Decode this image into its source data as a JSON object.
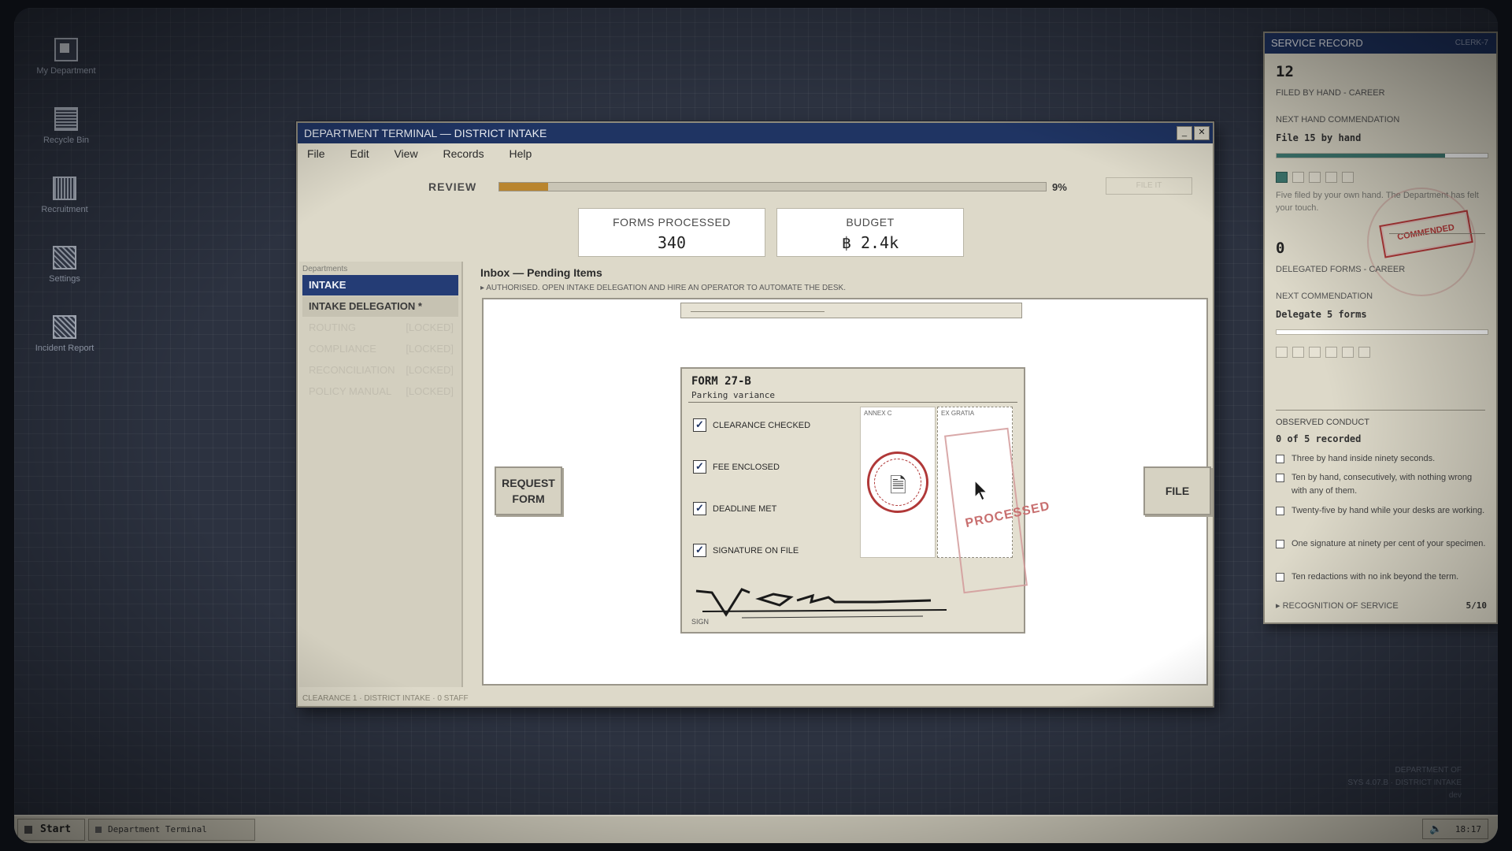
{
  "desktop": {
    "icons": [
      {
        "label": "My Department",
        "icon": "folder-icon"
      },
      {
        "label": "Recycle Bin",
        "icon": "recycle-bin-icon"
      },
      {
        "label": "Recruitment",
        "icon": "recruitment-icon"
      },
      {
        "label": "Settings",
        "icon": "settings-icon"
      },
      {
        "label": "Incident Report",
        "icon": "report-icon"
      }
    ],
    "system_info": [
      "DEPARTMENT OF",
      "SYS 4.07.B · DISTRICT INTAKE",
      "dev"
    ]
  },
  "window": {
    "title": "DEPARTMENT TERMINAL — DISTRICT INTAKE",
    "minimize": "_",
    "close": "✕",
    "menu": [
      "File",
      "Edit",
      "View",
      "Records",
      "Help"
    ],
    "review": {
      "label": "REVIEW",
      "progress_percent": 9,
      "percent_label": "9%",
      "file_it": "FILE IT"
    },
    "stats": {
      "forms_processed_label": "FORMS PROCESSED",
      "forms_processed_value": "340",
      "budget_label": "BUDGET",
      "budget_value": "฿ 2.4k"
    },
    "sidebar": {
      "heading": "Departments",
      "items": [
        {
          "label": "INTAKE",
          "state": "active"
        },
        {
          "label": "INTAKE DELEGATION *",
          "state": "available"
        },
        {
          "label": "ROUTING",
          "state": "locked",
          "lock": "[LOCKED]"
        },
        {
          "label": "COMPLIANCE",
          "state": "locked",
          "lock": "[LOCKED]"
        },
        {
          "label": "RECONCILIATION",
          "state": "locked",
          "lock": "[LOCKED]"
        },
        {
          "label": "POLICY MANUAL",
          "state": "locked",
          "lock": "[LOCKED]"
        }
      ]
    },
    "inbox": {
      "title": "Inbox — Pending Items",
      "notice": "▸ AUTHORISED. OPEN INTAKE DELEGATION AND HIRE AN OPERATOR TO AUTOMATE THE DESK."
    },
    "request_button": "REQUEST FORM",
    "file_button": "FILE",
    "form": {
      "title": "FORM 27-B",
      "subtitle": "Parking variance",
      "checks": [
        "CLEARANCE CHECKED",
        "FEE ENCLOSED",
        "DEADLINE MET",
        "SIGNATURE ON FILE"
      ],
      "check_mark": "✓",
      "annex_left": "ANNEX C",
      "annex_right": "EX GRATIA",
      "stamp_text": "PROCESSED",
      "signature_label": "SIGN"
    },
    "status": "CLEARANCE 1 · DISTRICT INTAKE · 0 STAFF"
  },
  "service_record": {
    "title": "SERVICE RECORD",
    "clerk": "CLERK-7",
    "filed_value": "12",
    "filed_label": "FILED BY HAND - CAREER",
    "next_hand_label": "NEXT HAND COMMENDATION",
    "next_hand_value": "File 15 by hand",
    "hand_progress_fraction": 0.8,
    "hand_pips": {
      "earned": 1,
      "total": 5
    },
    "hand_note": "Five filed by your own hand. The Department has felt your touch.",
    "commended_stamp": "COMMENDED",
    "delegated_value": "0",
    "delegated_label": "DELEGATED FORMS - CAREER",
    "next_comm_label": "NEXT COMMENDATION",
    "next_comm_value": "Delegate 5 forms",
    "delegated_progress_fraction": 0,
    "delegated_pips": {
      "earned": 0,
      "total": 6
    },
    "observed_label": "OBSERVED CONDUCT",
    "observed_count": "0 of 5 recorded",
    "objectives": [
      "Three by hand inside ninety seconds.",
      "Ten by hand, consecutively, with nothing wrong with any of them.",
      "Twenty-five by hand while your desks are working.",
      "One signature at ninety per cent of your specimen.",
      "Ten redactions with no ink beyond the term."
    ],
    "recognition_label": "▸ RECOGNITION OF SERVICE",
    "recognition_count": "5/10"
  },
  "taskbar": {
    "start": "Start",
    "task": "Department Terminal",
    "clock": "18:17"
  }
}
